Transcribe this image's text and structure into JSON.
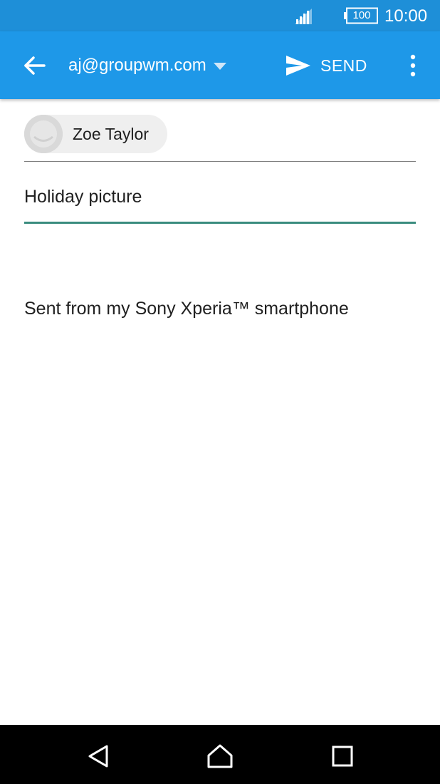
{
  "status_bar": {
    "signal_icon": "cellular-signal-icon",
    "battery_icon": "battery-icon",
    "battery_level": "100",
    "time": "10:00"
  },
  "app_bar": {
    "back_icon": "arrow-back-icon",
    "account": "aj@groupwm.com",
    "dropdown_icon": "triangle-down-icon",
    "send_icon": "send-icon",
    "send_label": "SEND",
    "overflow_icon": "more-vertical-icon",
    "color": "#1e98e8"
  },
  "compose": {
    "recipient": {
      "name": "Zoe Taylor",
      "avatar_icon": "contact-avatar-icon"
    },
    "subject": "Holiday picture",
    "body_signature": "Sent from my Sony Xperia™ smartphone",
    "focus_underline_color": "#3a8c7e"
  },
  "nav_bar": {
    "back_icon": "nav-back-triangle-icon",
    "home_icon": "nav-home-icon",
    "recents_icon": "nav-recents-square-icon"
  }
}
